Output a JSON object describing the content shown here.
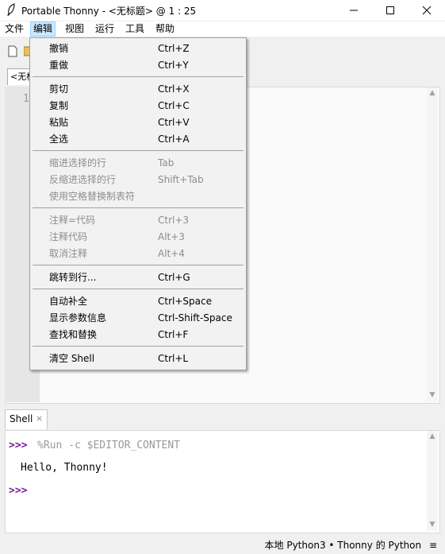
{
  "window": {
    "title": "Portable Thonny  -  <无标题>  @  1 : 25",
    "minimize": "—",
    "maximize": "☐",
    "close": "✕"
  },
  "menubar": [
    "文件",
    "编辑",
    "视图",
    "运行",
    "工具",
    "帮助"
  ],
  "editor": {
    "tab_label": "<无标题>",
    "line_number": "1"
  },
  "edit_menu": {
    "undo": {
      "label": "撤销",
      "shortcut": "Ctrl+Z"
    },
    "redo": {
      "label": "重做",
      "shortcut": "Ctrl+Y"
    },
    "cut": {
      "label": "剪切",
      "shortcut": "Ctrl+X"
    },
    "copy": {
      "label": "复制",
      "shortcut": "Ctrl+C"
    },
    "paste": {
      "label": "粘贴",
      "shortcut": "Ctrl+V"
    },
    "select_all": {
      "label": "全选",
      "shortcut": "Ctrl+A"
    },
    "indent": {
      "label": "缩进选择的行",
      "shortcut": "Tab"
    },
    "dedent": {
      "label": "反缩进选择的行",
      "shortcut": "Shift+Tab"
    },
    "replace_tabs": {
      "label": "使用空格替换制表符"
    },
    "uncomment_as_code": {
      "label": "注释=代码",
      "shortcut": "Ctrl+3"
    },
    "comment_out": {
      "label": "注释代码",
      "shortcut": "Alt+3"
    },
    "uncomment": {
      "label": "取消注释",
      "shortcut": "Alt+4"
    },
    "goto_line": {
      "label": "跳转到行...",
      "shortcut": "Ctrl+G"
    },
    "autocomplete": {
      "label": "自动补全",
      "shortcut": "Ctrl+Space"
    },
    "param_info": {
      "label": "显示参数信息",
      "shortcut": "Ctrl-Shift-Space"
    },
    "find_replace": {
      "label": "查找和替换",
      "shortcut": "Ctrl+F"
    },
    "clear_shell": {
      "label": "清空 Shell",
      "shortcut": "Ctrl+L"
    }
  },
  "shell": {
    "tab_label": "Shell",
    "tab_close": "×",
    "prompt": ">>>",
    "command": "%Run -c $EDITOR_CONTENT",
    "output": "Hello, Thonny!"
  },
  "status": {
    "interpreter": "本地 Python3 • Thonny 的 Python",
    "menu_icon": "≡"
  }
}
